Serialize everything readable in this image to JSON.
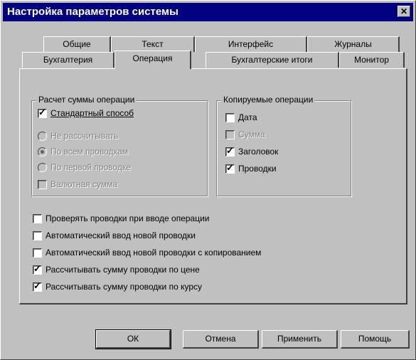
{
  "window": {
    "title": "Настройка параметров системы",
    "close_glyph": "✕"
  },
  "tabs_back": [
    {
      "label": "Общие"
    },
    {
      "label": "Текст"
    },
    {
      "label": "Интерфейс"
    },
    {
      "label": "Журналы"
    }
  ],
  "tabs_front": [
    {
      "label": "Бухгалтерия"
    },
    {
      "label": "Операция",
      "active": true
    },
    {
      "label": "Бухгалтерские итоги"
    },
    {
      "label": "Монитор"
    }
  ],
  "calc_group": {
    "title": "Расчет суммы операции",
    "standard": {
      "label": "Стандартный способ",
      "checked": true
    },
    "options": [
      {
        "label": "Не рассчитывать",
        "selected": false
      },
      {
        "label": "По всем проводкам",
        "selected": true
      },
      {
        "label": "По первой проводке",
        "selected": false
      }
    ],
    "currency": {
      "label": "Валютная сумма",
      "checked": false
    }
  },
  "copy_group": {
    "title": "Копируемые операции",
    "items": [
      {
        "label": "Дата",
        "checked": false,
        "enabled": true
      },
      {
        "label": "Сумма",
        "checked": false,
        "enabled": false
      },
      {
        "label": "Заголовок",
        "checked": true,
        "enabled": true
      },
      {
        "label": "Проводки",
        "checked": true,
        "enabled": true
      }
    ]
  },
  "options": [
    {
      "label": "Проверять проводки при вводе операции",
      "checked": false
    },
    {
      "label": "Автоматический ввод новой проводки",
      "checked": false
    },
    {
      "label": "Автоматический ввод новой проводки с копированием",
      "checked": false
    },
    {
      "label": "Рассчитывать сумму проводки по цене",
      "checked": true
    },
    {
      "label": "Рассчитывать сумму проводки по курсу",
      "checked": true
    }
  ],
  "buttons": {
    "ok": "ОК",
    "cancel": "Отмена",
    "apply": "Применить",
    "help": "Помощь"
  }
}
